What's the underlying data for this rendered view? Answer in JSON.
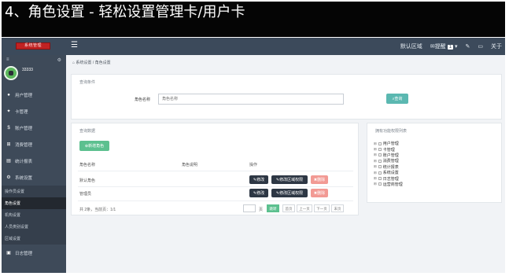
{
  "slide_title": "4、角色设置 - 轻松设置管理卡/用户卡",
  "topbar": {
    "logo_text": "系统管理",
    "menu_icon": "hamburger-icon",
    "region": "默认区域",
    "mail_label": "提醒",
    "mail_count": "1",
    "about": "关于"
  },
  "sidebar": {
    "username": "33333",
    "items": [
      {
        "label": "用户管理",
        "icon": "user-icon"
      },
      {
        "label": "卡管理",
        "icon": "card-icon"
      },
      {
        "label": "账户管理",
        "icon": "dollar-icon"
      },
      {
        "label": "消费管理",
        "icon": "cart-icon"
      },
      {
        "label": "统计报表",
        "icon": "chart-icon"
      },
      {
        "label": "系统设置",
        "icon": "gear-icon"
      }
    ],
    "subitems": [
      "操作员设置",
      "角色设置",
      "机构设置",
      "人员类别设置",
      "区域设置"
    ],
    "footer_item": {
      "label": "日志管理",
      "icon": "log-icon"
    }
  },
  "breadcrumb": {
    "home": "系统设置",
    "current": "角色设置"
  },
  "search_panel": {
    "title": "查询条件",
    "label": "角色名称",
    "placeholder": "角色名称",
    "search_button": "查询"
  },
  "data_panel": {
    "title": "查询数据",
    "add_button": "新增角色",
    "headers": [
      "角色名称",
      "角色说明",
      "操作"
    ],
    "rows": [
      {
        "name": "默认角色",
        "desc": ""
      },
      {
        "name": "管理员",
        "desc": ""
      }
    ],
    "actions": {
      "edit": "修改",
      "region": "修改区域权限",
      "delete": "删除"
    },
    "pager": {
      "summary": "共 2条，当前页：1/1",
      "page_label": "页",
      "go": "跳转",
      "first": "首页",
      "prev": "上一页",
      "next": "下一页",
      "last": "末页"
    }
  },
  "perm_panel": {
    "title": "拥有功能权限列表",
    "items": [
      "用户管理",
      "卡管理",
      "账户管理",
      "消费管理",
      "统计报表",
      "系统设置",
      "日志管理",
      "运营商管理"
    ]
  },
  "colors": {
    "topbar": "#3c4a5b",
    "sidebar": "#3e4a59",
    "teal": "#5bb8b1",
    "green": "#5cc08f",
    "dark": "#2d3744",
    "red": "#f29a94"
  }
}
